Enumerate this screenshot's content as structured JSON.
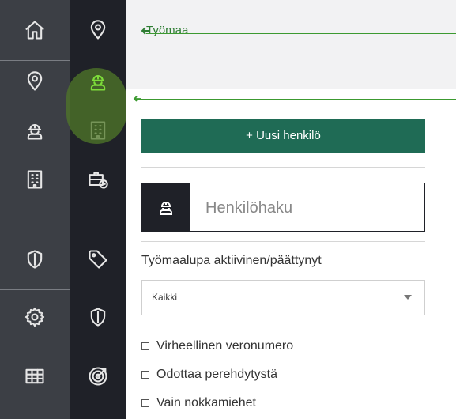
{
  "breadcrumb": {
    "title": "Työmaa"
  },
  "rail_primary": {
    "items": [
      {
        "icon": "home-icon"
      },
      {
        "icon": "map-pin-icon"
      },
      {
        "icon": "worker-icon"
      },
      {
        "icon": "building-icon"
      },
      {
        "icon": "shield-icon"
      },
      {
        "icon": "gear-icon"
      },
      {
        "icon": "grid-table-icon"
      }
    ]
  },
  "rail_secondary": {
    "items": [
      {
        "icon": "map-pin-icon"
      },
      {
        "icon": "worker-icon",
        "active": true,
        "color": "#7ddc3a"
      },
      {
        "icon": "building-icon"
      },
      {
        "icon": "toolbox-clock-icon"
      },
      {
        "icon": "tag-icon"
      },
      {
        "icon": "shield-icon"
      },
      {
        "icon": "target-icon"
      }
    ]
  },
  "actions": {
    "new_person_label": "+ Uusi henkilö",
    "button_color": "#1f6b55"
  },
  "search": {
    "placeholder": "Henkilöhaku"
  },
  "filter": {
    "label": "Työmaalupa aktiivinen/päättynyt",
    "selected": "Kaikki"
  },
  "checkboxes": [
    {
      "label": "Virheellinen veronumero",
      "checked": false
    },
    {
      "label": "Odottaa perehdytystä",
      "checked": false
    },
    {
      "label": "Vain nokkamiehet",
      "checked": false
    }
  ],
  "colors": {
    "accent": "#2e7d32",
    "rail_dark": "#1f2128",
    "rail_mid": "#3c3f45"
  }
}
